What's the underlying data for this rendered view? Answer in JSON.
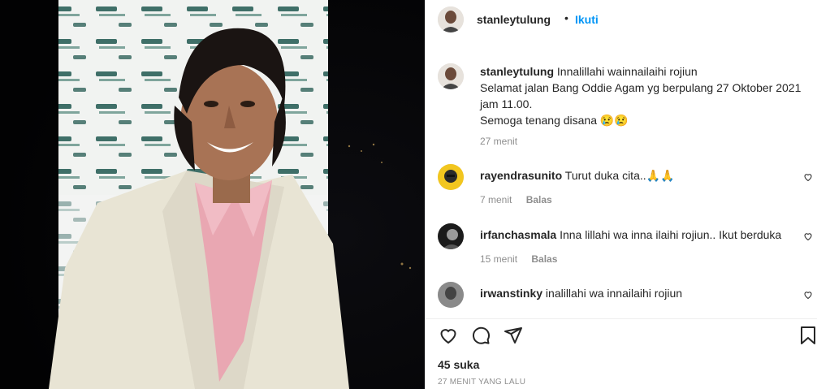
{
  "post": {
    "author": "stanleytulung",
    "separator": "•",
    "follow_label": "Ikuti",
    "caption_lines": [
      "Innalillahi wainnailaihi rojiun",
      "Selamat jalan Bang Oddie Agam yg berpulang 27 Oktober 2021",
      "jam 11.00.",
      "Semoga tenang disana 😢😢"
    ],
    "caption_time": "27 menit",
    "likes": "45 suka",
    "timestamp": "27 MENIT YANG LALU"
  },
  "comments": [
    {
      "user": "rayendrasunito",
      "text": "Turut duka cita..🙏🙏",
      "time": "7 menit",
      "reply_label": "Balas"
    },
    {
      "user": "irfanchasmala",
      "text": "Inna lillahi wa inna ilaihi rojiun.. Ikut berduka",
      "time": "15 menit",
      "reply_label": "Balas"
    },
    {
      "user": "irwanstinky",
      "text": "inalillahi wa innailaihi rojiun",
      "time": "",
      "reply_label": ""
    }
  ],
  "icons": {
    "like": "heart-icon",
    "comment": "comment-icon",
    "share": "paper-plane-icon",
    "save": "bookmark-icon"
  }
}
